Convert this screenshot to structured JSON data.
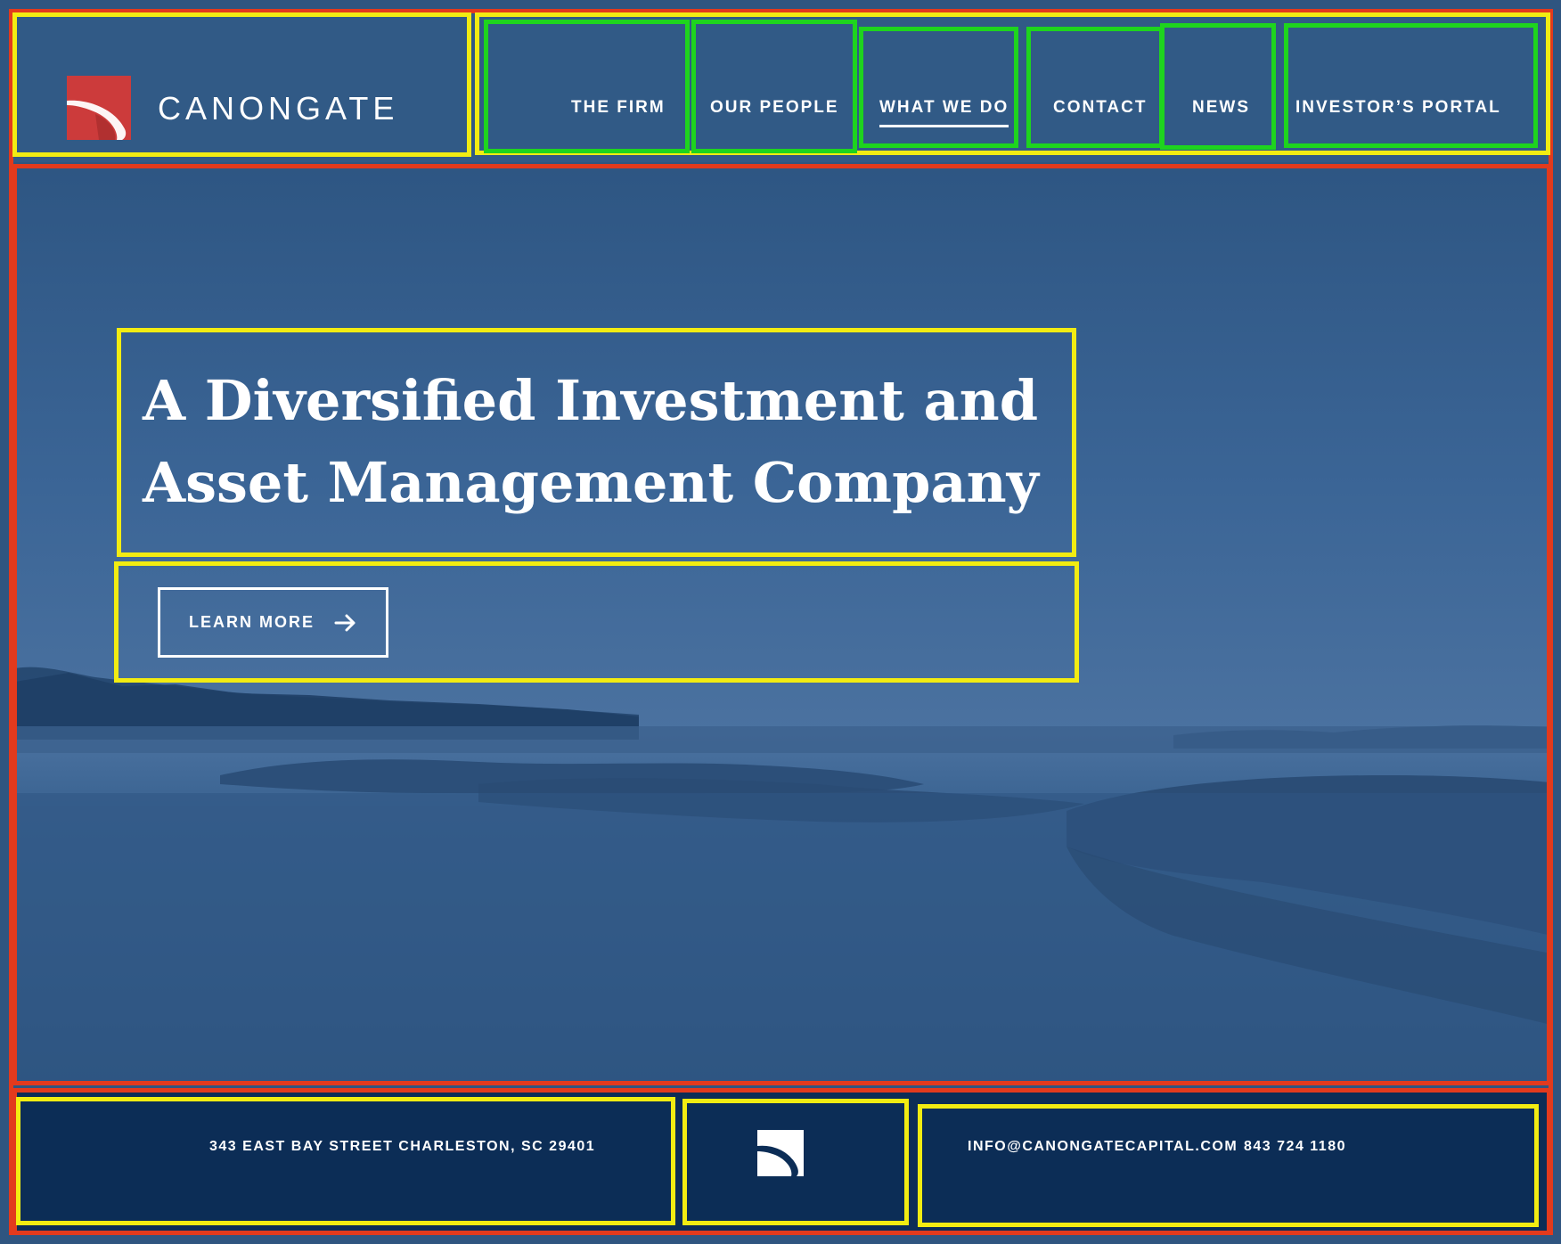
{
  "brand": {
    "name": "CANONGATE",
    "logo_color": "#cc3b3b"
  },
  "nav": {
    "items": [
      {
        "label": "THE FIRM"
      },
      {
        "label": "OUR PEOPLE"
      },
      {
        "label": "WHAT WE DO",
        "active": true
      },
      {
        "label": "CONTACT"
      },
      {
        "label": "NEWS"
      },
      {
        "label": "INVESTOR’S PORTAL"
      }
    ]
  },
  "hero": {
    "headline_line1": "A Diversified Investment and",
    "headline_line2": "Asset Management Company",
    "cta_label": "LEARN MORE",
    "cta_icon": "arrow-right-icon"
  },
  "footer": {
    "address": "343 EAST BAY STREET  CHARLESTON, SC 29401",
    "email": "INFO@CANONGATECAPITAL.COM",
    "phone": "843 724 1180",
    "logo_icon": "canongate-mark-icon"
  },
  "colors": {
    "header_bg": "#315a86",
    "footer_bg": "#0c2d56",
    "annotation_yellow": "#f2ec12",
    "annotation_green": "#1ed41e",
    "annotation_red": "#e23a1d"
  }
}
